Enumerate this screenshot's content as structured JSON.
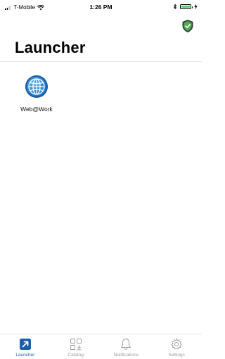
{
  "status_bar": {
    "carrier": "T-Mobile",
    "time": "1:26 PM",
    "battery_level": 1.0,
    "battery_color": "#4cd964"
  },
  "header": {
    "title": "Launcher",
    "shield_icon": "shield-check-icon",
    "shield_color": "#4caf50"
  },
  "apps": [
    {
      "label": "Web@Work",
      "icon": "globe-icon"
    }
  ],
  "tab_bar": {
    "accent": "#1a5fa8",
    "inactive_color": "#9a9a9a",
    "tabs": [
      {
        "label": "Launcher",
        "icon": "launcher-icon",
        "active": true
      },
      {
        "label": "Catalog",
        "icon": "catalog-icon",
        "active": false
      },
      {
        "label": "Notifications",
        "icon": "bell-icon",
        "active": false
      },
      {
        "label": "Settings",
        "icon": "gear-icon",
        "active": false
      }
    ]
  }
}
